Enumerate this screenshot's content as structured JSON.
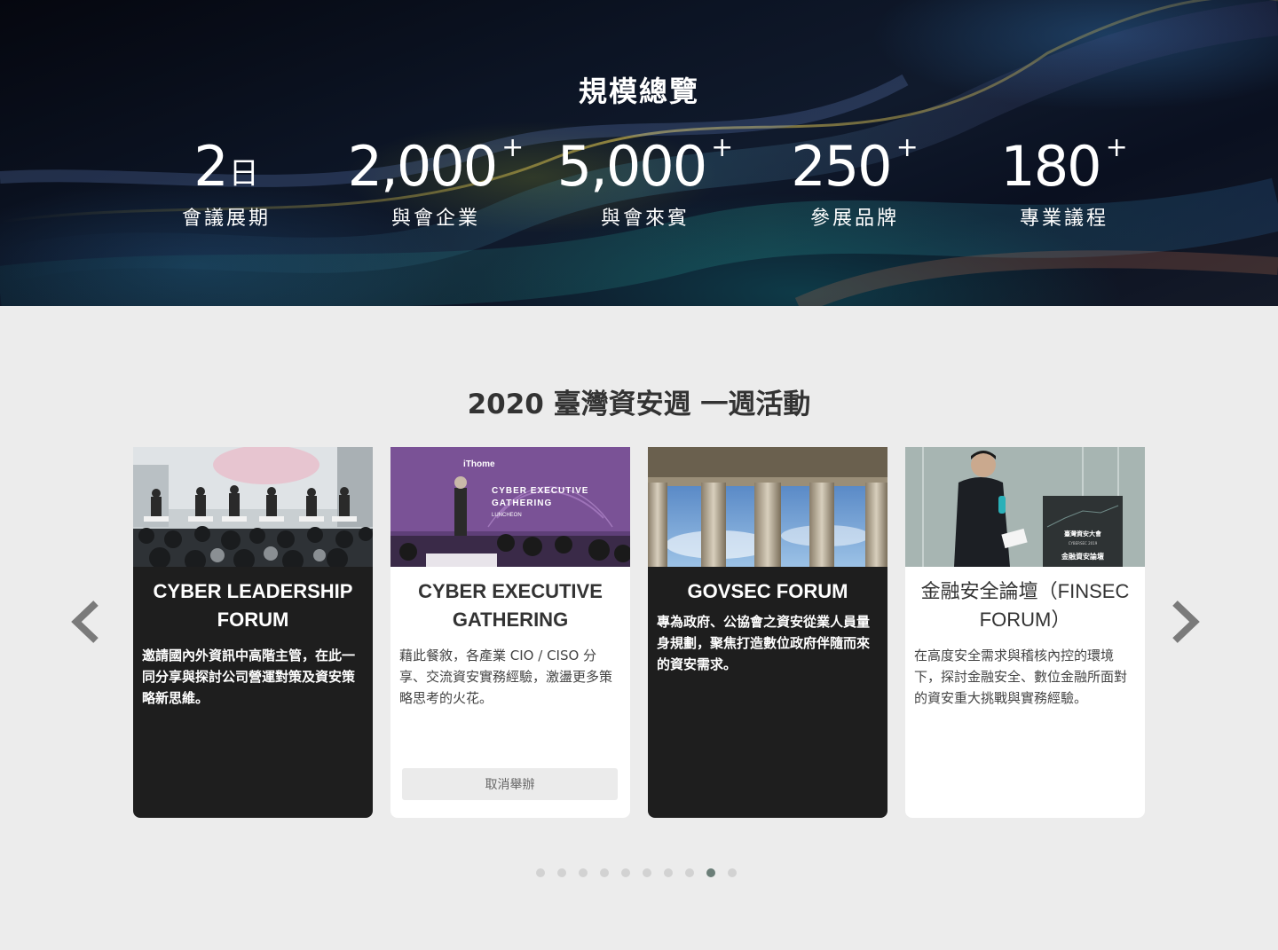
{
  "hero": {
    "title": "規模總覽",
    "stats": [
      {
        "number": "2",
        "unit": "日",
        "plus": "",
        "label": "會議展期"
      },
      {
        "number": "2,000",
        "unit": "",
        "plus": "+",
        "label": "與會企業"
      },
      {
        "number": "5,000",
        "unit": "",
        "plus": "+",
        "label": "與會來賓"
      },
      {
        "number": "250",
        "unit": "",
        "plus": "+",
        "label": "參展品牌"
      },
      {
        "number": "180",
        "unit": "",
        "plus": "+",
        "label": "專業議程"
      }
    ]
  },
  "events": {
    "title": "2020 臺灣資安週 一週活動",
    "cards": [
      {
        "theme": "dark",
        "title": "CYBER LEADERSHIP FORUM",
        "description": "邀請國內外資訊中高階主管，在此一同分享與探討公司營運對策及資安策略新思維。"
      },
      {
        "theme": "light",
        "title": "CYBER EXECUTIVE GATHERING",
        "description": "藉此餐敘，各產業 CIO / CISO 分享、交流資安實務經驗，激盪更多策略思考的火花。",
        "photo_text": [
          "iThome",
          "CYBER EXECUTIVE",
          "GATHERING",
          "LUNCHEON"
        ],
        "button_label": "取消舉辦"
      },
      {
        "theme": "dark",
        "title": "GOVSEC FORUM",
        "description": "專為政府、公協會之資安從業人員量身規劃，聚焦打造數位政府伴隨而來的資安需求。"
      },
      {
        "theme": "light",
        "title": "金融安全論壇（FINSEC FORUM）",
        "description": "在高度安全需求與稽核內控的環境下，探討金融安全、數位金融所面對的資安重大挑戰與實務經驗。",
        "photo_text": [
          "臺灣資安大會",
          "CYBERSEC 2019",
          "金融資安論壇"
        ]
      }
    ],
    "pagination": {
      "count": 10,
      "active_index": 8
    }
  },
  "icons": {
    "prev": "chevron-left-icon",
    "next": "chevron-right-icon"
  },
  "colors": {
    "dark_card": "#1e1e1e",
    "light_card": "#ffffff",
    "page_bg": "#ececec",
    "active_dot": "#6b7e78"
  }
}
